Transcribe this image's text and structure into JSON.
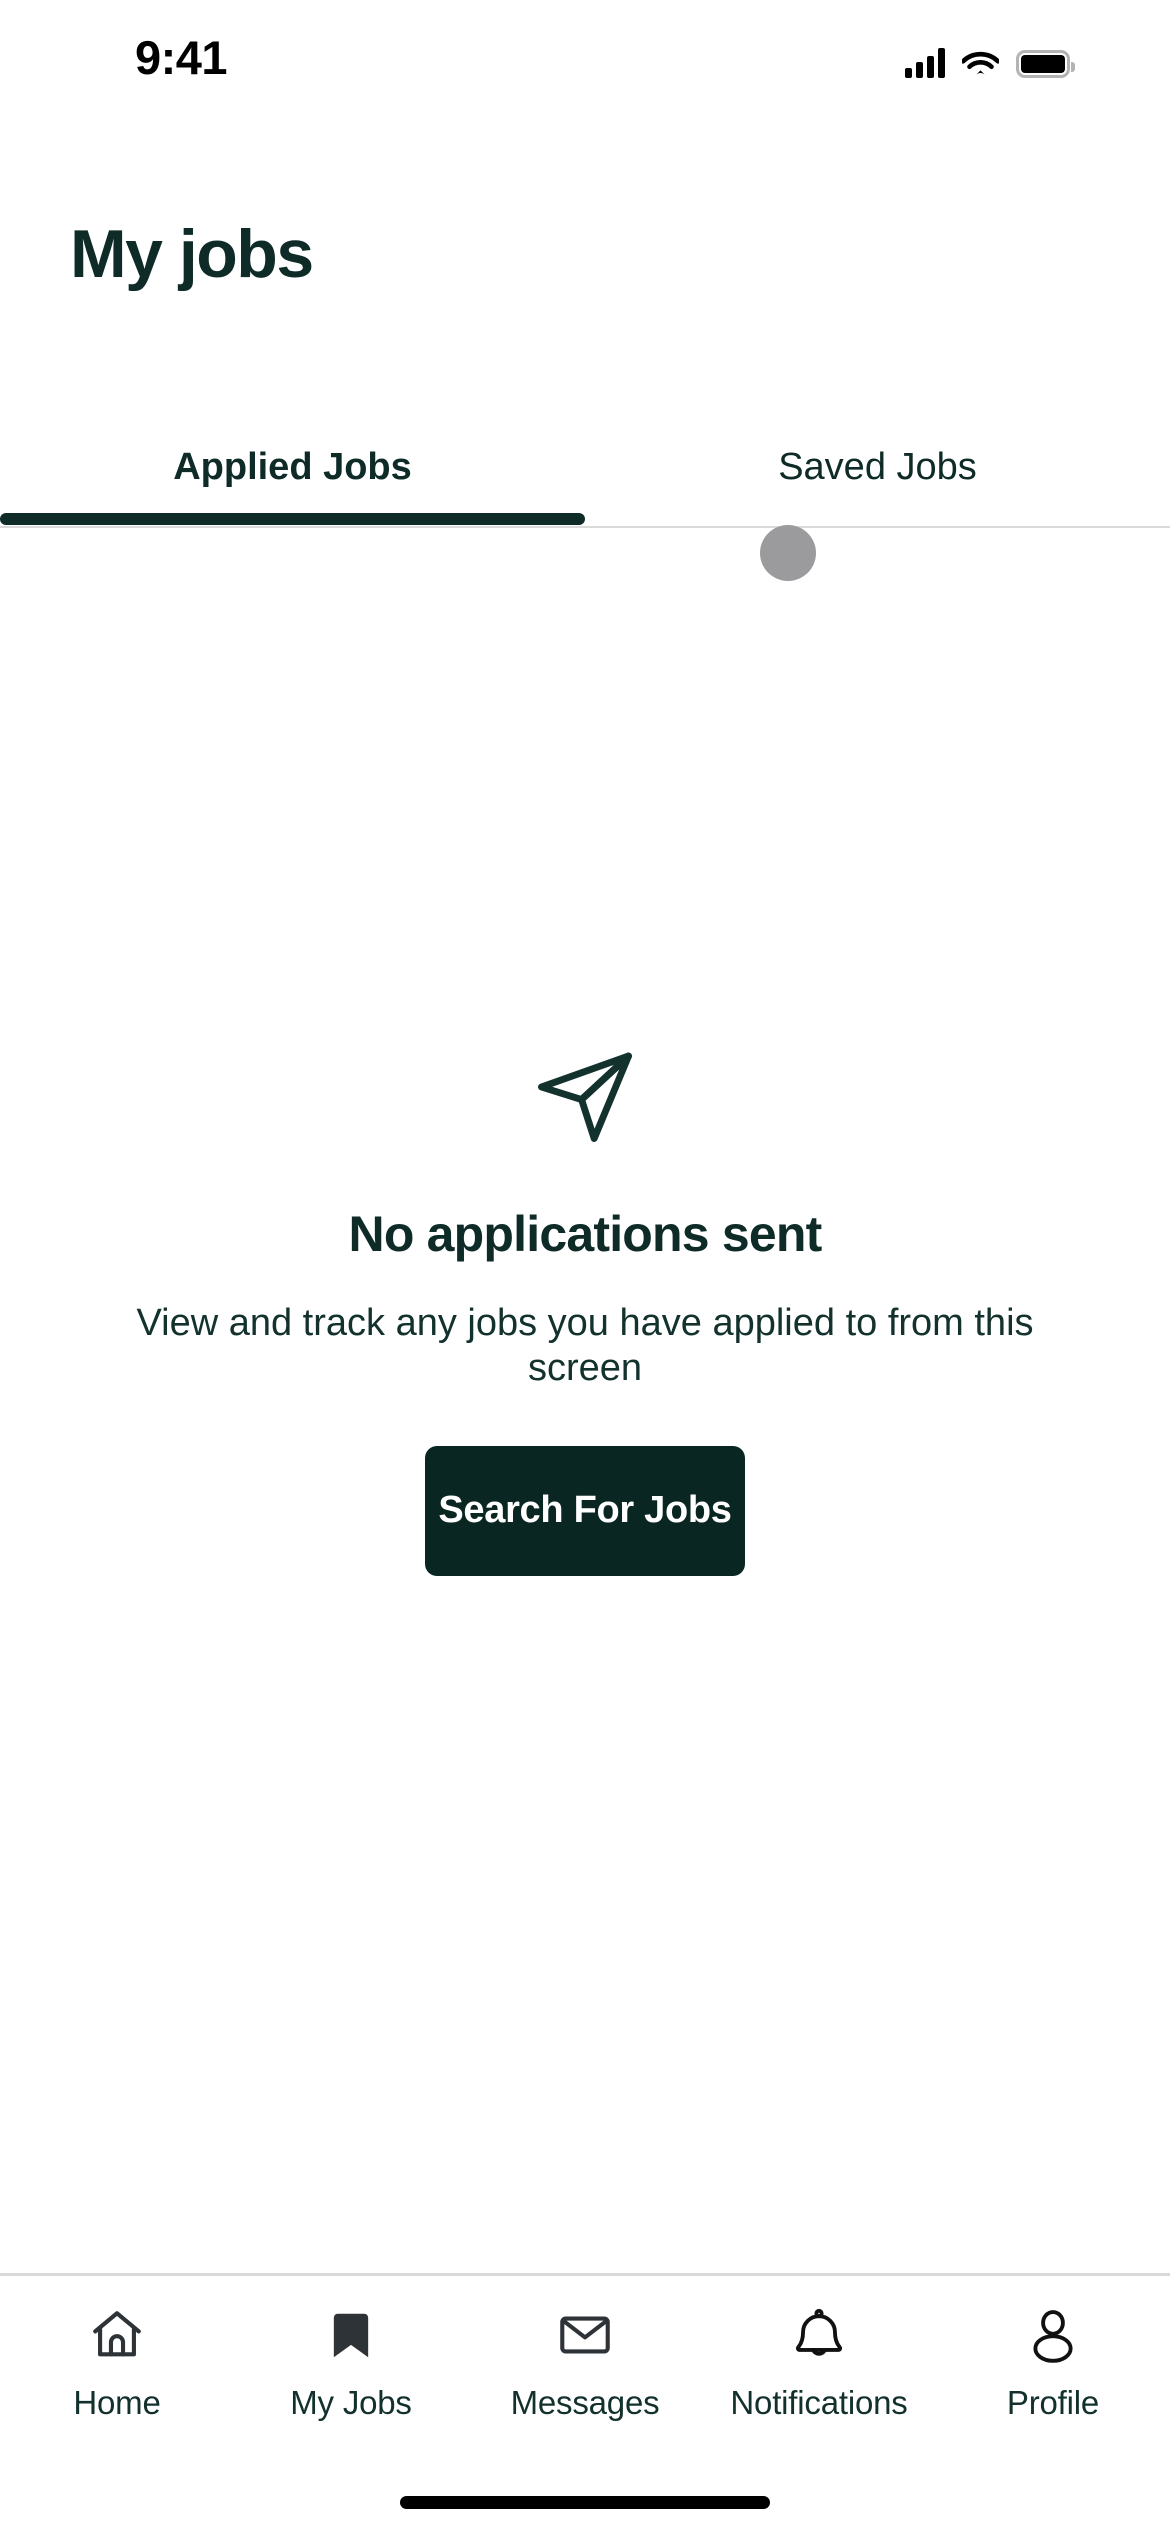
{
  "status_bar": {
    "time": "9:41",
    "signal_icon": "cellular-signal-icon",
    "wifi_icon": "wifi-icon",
    "battery_icon": "battery-full-icon"
  },
  "header": {
    "title": "My jobs"
  },
  "tabs": {
    "items": [
      {
        "label": "Applied Jobs",
        "active": true
      },
      {
        "label": "Saved Jobs",
        "active": false
      }
    ],
    "active_index": 0
  },
  "empty_state": {
    "icon": "paper-plane-icon",
    "title": "No applications sent",
    "description": "View and track any jobs you have applied to from this screen",
    "cta_label": "Search For Jobs"
  },
  "bottom_nav": {
    "items": [
      {
        "label": "Home",
        "icon": "home-icon",
        "active": false
      },
      {
        "label": "My Jobs",
        "icon": "bookmark-filled-icon",
        "active": true
      },
      {
        "label": "Messages",
        "icon": "envelope-icon",
        "active": false
      },
      {
        "label": "Notifications",
        "icon": "bell-icon",
        "active": false
      },
      {
        "label": "Profile",
        "icon": "person-icon",
        "active": false
      }
    ]
  },
  "colors": {
    "brand_dark": "#0E2B28",
    "button_bg": "#0A2622",
    "touch_indicator": "#9B9B9E",
    "divider": "#DADADA"
  }
}
